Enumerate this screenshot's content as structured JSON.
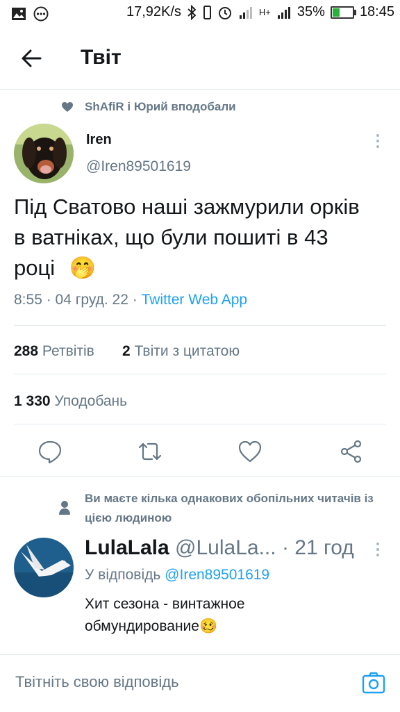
{
  "status_bar": {
    "speed": "17,92K/s",
    "network": "H+",
    "battery_percent": "35%",
    "battery_level": 0.35,
    "time": "18:45"
  },
  "header": {
    "title": "Твіт"
  },
  "tweet": {
    "liked_by": "ShAfiR і Юрий вподобали",
    "author_name": "Iren",
    "author_handle": "@Iren89501619",
    "text": "Під Сватово наші зажмурили орків в ватніках, що були пошиті в 43 році",
    "emoji": "🤭",
    "timestamp": "8:55 · 04 груд. 22 · ",
    "source": "Twitter Web App",
    "retweets_count": "288",
    "retweets_label": "Ретвітів",
    "quotes_count": "2",
    "quotes_label": "Твіти з цитатою",
    "likes_count": "1 330",
    "likes_label": "Уподобань"
  },
  "reply": {
    "followers_note": "Ви маєте кілька однакових обопільних читачів із цією людиною",
    "author_name": "LulaLala",
    "author_handle": "@LulaLa...",
    "time_ago": "· 21 год",
    "reply_to_label": "У відповідь",
    "reply_to_handle": "@Iren89501619",
    "text": "Хит сезона - винтажное обмундирование🥴"
  },
  "compose": {
    "placeholder": "Твітніть свою відповідь"
  },
  "colors": {
    "accent": "#1da1f2",
    "secondary_text": "#657786",
    "primary_text": "#14171a",
    "divider": "#e1e8ed"
  },
  "icons": [
    "image-icon",
    "more-dots-icon",
    "bluetooth-icon",
    "vibrate-icon",
    "alarm-icon",
    "signal-icon",
    "battery-icon",
    "back-arrow-icon",
    "heart-icon",
    "kebab-icon",
    "reply-icon",
    "retweet-icon",
    "like-icon",
    "share-icon",
    "person-icon",
    "camera-icon"
  ]
}
